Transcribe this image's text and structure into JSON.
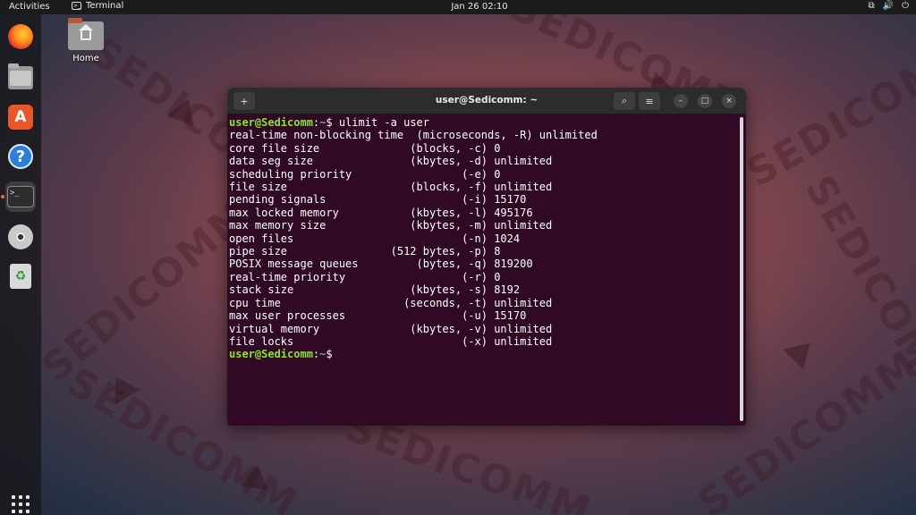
{
  "topbar": {
    "activities": "Activities",
    "app_name": "Terminal",
    "app_icon_glyph": ">_",
    "datetime": "Jan 26  02:10",
    "tray": {
      "network": "⧉",
      "volume": "🔊",
      "power": "⏻"
    }
  },
  "dock": {
    "items": [
      {
        "name": "firefox-icon"
      },
      {
        "name": "files-icon"
      },
      {
        "name": "software-store-icon",
        "glyph": "A"
      },
      {
        "name": "help-icon",
        "glyph": "?"
      },
      {
        "name": "terminal-icon",
        "glyph": ">_"
      },
      {
        "name": "cd-icon"
      },
      {
        "name": "trash-icon",
        "glyph": "♻"
      }
    ]
  },
  "desktop": {
    "home_label": "Home"
  },
  "watermark": {
    "text": "SEDICOMM"
  },
  "terminal": {
    "title": "user@Sedicomm: ~",
    "new_tab_icon": "+",
    "search_icon": "⌕",
    "menu_icon": "≡",
    "minimize_icon": "–",
    "maximize_icon": "□",
    "close_icon": "×",
    "prompt_user": "user@Sedicomm",
    "prompt_sep": ":",
    "prompt_path": "~",
    "prompt_symbol": "$",
    "command": " ulimit -a user",
    "output": [
      "real-time non-blocking time  (microseconds, -R) unlimited",
      "core file size              (blocks, -c) 0",
      "data seg size               (kbytes, -d) unlimited",
      "scheduling priority                 (-e) 0",
      "file size                   (blocks, -f) unlimited",
      "pending signals                     (-i) 15170",
      "max locked memory           (kbytes, -l) 495176",
      "max memory size             (kbytes, -m) unlimited",
      "open files                          (-n) 1024",
      "pipe size                (512 bytes, -p) 8",
      "POSIX message queues         (bytes, -q) 819200",
      "real-time priority                  (-r) 0",
      "stack size                  (kbytes, -s) 8192",
      "cpu time                   (seconds, -t) unlimited",
      "max user processes                  (-u) 15170",
      "virtual memory              (kbytes, -v) unlimited",
      "file locks                          (-x) unlimited"
    ]
  }
}
